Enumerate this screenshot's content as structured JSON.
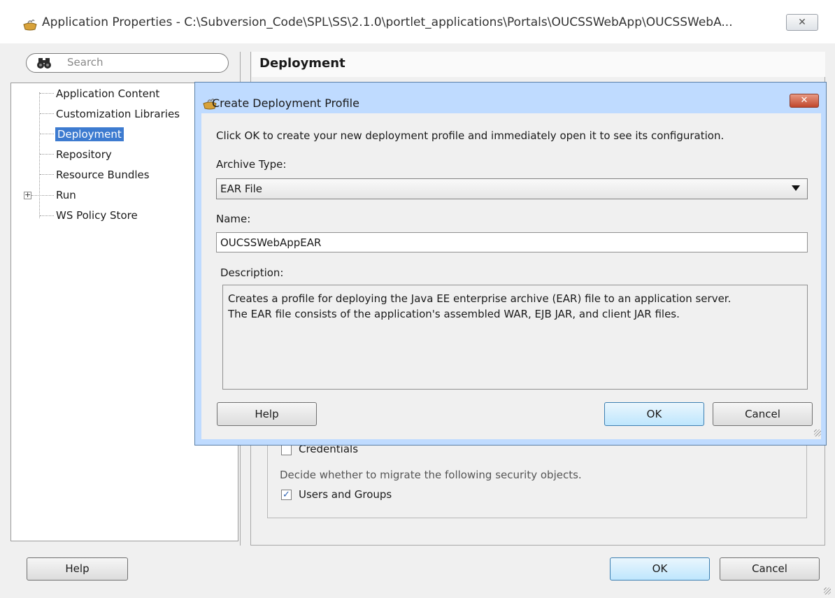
{
  "window": {
    "title": "Application Properties - C:\\Subversion_Code\\SPL\\SS\\2.1.0\\portlet_applications\\Portals\\OUCSSWebApp\\OUCSSWebA...",
    "close_glyph": "✕"
  },
  "search": {
    "placeholder": "Search",
    "icon": "binoculars-icon"
  },
  "tree": {
    "items": [
      {
        "label": "Application Content"
      },
      {
        "label": "Customization Libraries"
      },
      {
        "label": "Deployment",
        "selected": true
      },
      {
        "label": "Repository"
      },
      {
        "label": "Resource Bundles"
      },
      {
        "label": "Run",
        "expandable": true
      },
      {
        "label": "WS Policy Store"
      }
    ]
  },
  "right_panel": {
    "heading": "Deployment",
    "credentials_label": "Credentials",
    "credentials_checked": false,
    "migrate_text": "Decide whether to migrate the following security objects.",
    "users_groups_label": "Users and Groups",
    "users_groups_checked": true
  },
  "outer_buttons": {
    "help": "Help",
    "ok": "OK",
    "cancel": "Cancel"
  },
  "dialog": {
    "title": "Create Deployment Profile",
    "close_glyph": "✕",
    "intro": "Click OK to create your new deployment profile and immediately open it to see its configuration.",
    "archive_type_label": "Archive Type:",
    "archive_type_value": "EAR File",
    "name_label": "Name:",
    "name_value": "OUCSSWebAppEAR",
    "description_label": "Description:",
    "description_line1": "Creates a profile for deploying the Java EE enterprise archive (EAR) file to an application server.",
    "description_line2": "The EAR file consists of the application's assembled WAR, EJB JAR, and client JAR files.",
    "help": "Help",
    "ok": "OK",
    "cancel": "Cancel"
  }
}
